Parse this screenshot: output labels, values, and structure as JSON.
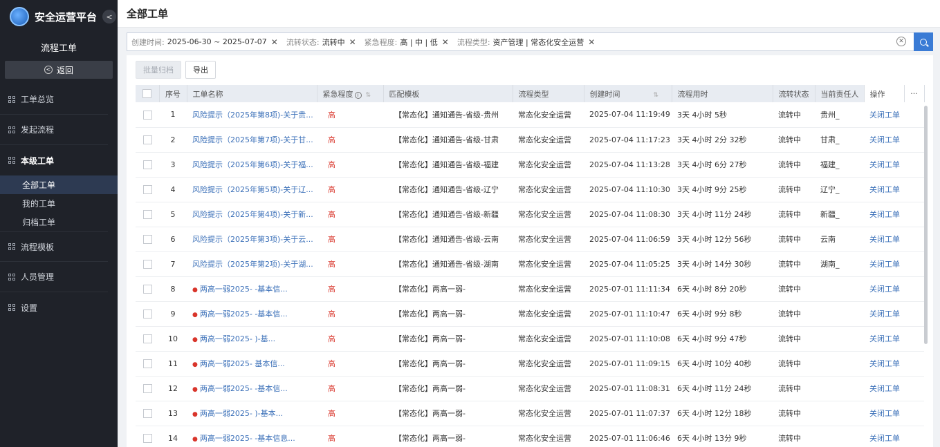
{
  "brand": {
    "title": "安全运营平台",
    "collapse_icon": "chevron-left-icon"
  },
  "sidebar": {
    "section_title": "流程工单",
    "back_label": "返回",
    "groups": [
      {
        "label": "工单总览"
      },
      {
        "label": "发起流程"
      },
      {
        "label": "本级工单"
      },
      {
        "label": "流程模板"
      },
      {
        "label": "人员管理"
      },
      {
        "label": "设置"
      }
    ],
    "sub_items": [
      {
        "label": "全部工单"
      },
      {
        "label": "我的工单"
      },
      {
        "label": "归档工单"
      }
    ]
  },
  "header": {
    "title": "全部工单"
  },
  "filters": [
    {
      "key": "创建时间:",
      "value": "2025-06-30 ~ 2025-07-07"
    },
    {
      "key": "流转状态:",
      "value": "流转中"
    },
    {
      "key": "紧急程度:",
      "value": "高 | 中 | 低"
    },
    {
      "key": "流程类型:",
      "value": "资产管理 | 常态化安全运营"
    }
  ],
  "toolbar": {
    "batch_archive": "批量归档",
    "export": "导出"
  },
  "table": {
    "columns": [
      "序号",
      "工单名称",
      "紧急程度",
      "匹配模板",
      "流程类型",
      "创建时间",
      "流程用时",
      "流转状态",
      "当前责任人",
      "操作",
      "···"
    ],
    "rows": [
      {
        "no": "1",
        "name": "风险提示（2025年第8项)-关于贵...",
        "urgency": "高",
        "template": "【常态化】通知通告-省级-贵州",
        "type": "常态化安全运营",
        "created": "2025-07-04 11:19:49",
        "duration": "3天 4小时 5秒",
        "status": "流转中",
        "owner": "贵州_",
        "action": "关闭工单",
        "dot": false
      },
      {
        "no": "2",
        "name": "风险提示（2025年第7项)-关于甘...",
        "urgency": "高",
        "template": "【常态化】通知通告-省级-甘肃",
        "type": "常态化安全运营",
        "created": "2025-07-04 11:17:23",
        "duration": "3天 4小时 2分 32秒",
        "status": "流转中",
        "owner": "甘肃_",
        "action": "关闭工单",
        "dot": false
      },
      {
        "no": "3",
        "name": "风险提示（2025年第6项)-关于福...",
        "urgency": "高",
        "template": "【常态化】通知通告-省级-福建",
        "type": "常态化安全运营",
        "created": "2025-07-04 11:13:28",
        "duration": "3天 4小时 6分 27秒",
        "status": "流转中",
        "owner": "福建_",
        "action": "关闭工单",
        "dot": false
      },
      {
        "no": "4",
        "name": "风险提示（2025年第5项)-关于辽...",
        "urgency": "高",
        "template": "【常态化】通知通告-省级-辽宁",
        "type": "常态化安全运营",
        "created": "2025-07-04 11:10:30",
        "duration": "3天 4小时 9分 25秒",
        "status": "流转中",
        "owner": "辽宁_",
        "action": "关闭工单",
        "dot": false
      },
      {
        "no": "5",
        "name": "风险提示（2025年第4项)-关于新...",
        "urgency": "高",
        "template": "【常态化】通知通告-省级-新疆",
        "type": "常态化安全运营",
        "created": "2025-07-04 11:08:30",
        "duration": "3天 4小时 11分 24秒",
        "status": "流转中",
        "owner": "新疆_",
        "action": "关闭工单",
        "dot": false
      },
      {
        "no": "6",
        "name": "风险提示（2025年第3项)-关于云...",
        "urgency": "高",
        "template": "【常态化】通知通告-省级-云南",
        "type": "常态化安全运营",
        "created": "2025-07-04 11:06:59",
        "duration": "3天 4小时 12分 56秒",
        "status": "流转中",
        "owner": "云南",
        "action": "关闭工单",
        "dot": false
      },
      {
        "no": "7",
        "name": "风险提示（2025年第2项)-关于湖...",
        "urgency": "高",
        "template": "【常态化】通知通告-省级-湖南",
        "type": "常态化安全运营",
        "created": "2025-07-04 11:05:25",
        "duration": "3天 4小时 14分 30秒",
        "status": "流转中",
        "owner": "湖南_",
        "action": "关闭工单",
        "dot": false
      },
      {
        "no": "8",
        "name": "两高一弱2025-  -基本信...",
        "urgency": "高",
        "template": "【常态化】两高一弱-",
        "type": "常态化安全运营",
        "created": "2025-07-01 11:11:34",
        "duration": "6天 4小时 8分 20秒",
        "status": "流转中",
        "owner": "",
        "action": "关闭工单",
        "dot": true
      },
      {
        "no": "9",
        "name": "两高一弱2025-  -基本信...",
        "urgency": "高",
        "template": "【常态化】两高一弱-",
        "type": "常态化安全运营",
        "created": "2025-07-01 11:10:47",
        "duration": "6天 4小时 9分 8秒",
        "status": "流转中",
        "owner": "",
        "action": "关闭工单",
        "dot": true
      },
      {
        "no": "10",
        "name": "两高一弱2025-  )-基...",
        "urgency": "高",
        "template": "【常态化】两高一弱-",
        "type": "常态化安全运营",
        "created": "2025-07-01 11:10:08",
        "duration": "6天 4小时 9分 47秒",
        "status": "流转中",
        "owner": "",
        "action": "关闭工单",
        "dot": true
      },
      {
        "no": "11",
        "name": "两高一弱2025-  基本信...",
        "urgency": "高",
        "template": "【常态化】两高一弱-",
        "type": "常态化安全运营",
        "created": "2025-07-01 11:09:15",
        "duration": "6天 4小时 10分 40秒",
        "status": "流转中",
        "owner": "",
        "action": "关闭工单",
        "dot": true
      },
      {
        "no": "12",
        "name": "两高一弱2025-  -基本信...",
        "urgency": "高",
        "template": "【常态化】两高一弱-",
        "type": "常态化安全运营",
        "created": "2025-07-01 11:08:31",
        "duration": "6天 4小时 11分 24秒",
        "status": "流转中",
        "owner": "",
        "action": "关闭工单",
        "dot": true
      },
      {
        "no": "13",
        "name": "两高一弱2025-  )-基本...",
        "urgency": "高",
        "template": "【常态化】两高一弱-",
        "type": "常态化安全运营",
        "created": "2025-07-01 11:07:37",
        "duration": "6天 4小时 12分 18秒",
        "status": "流转中",
        "owner": "",
        "action": "关闭工单",
        "dot": true
      },
      {
        "no": "14",
        "name": "两高一弱2025-  -基本信息...",
        "urgency": "高",
        "template": "【常态化】两高一弱-",
        "type": "常态化安全运营",
        "created": "2025-07-01 11:06:46",
        "duration": "6天 4小时 13分 9秒",
        "status": "流转中",
        "owner": "",
        "action": "关闭工单",
        "dot": true
      }
    ]
  }
}
